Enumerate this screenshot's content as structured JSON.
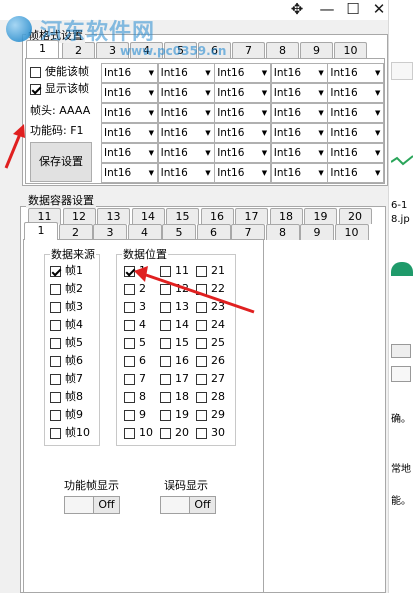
{
  "window": {
    "minimize_glyph": "—",
    "maximize_glyph": "☐",
    "close_glyph": "✕",
    "move_glyph": "✥"
  },
  "watermark": {
    "text": "河东软件网",
    "url": "www.pc0359.cn"
  },
  "frame_settings": {
    "legend": "帧格式设置",
    "tabs": [
      "1",
      "2",
      "3",
      "4",
      "5",
      "6",
      "7",
      "8",
      "9",
      "10"
    ],
    "enable_frame_label": "使能该帧",
    "enable_frame_checked": false,
    "show_frame_label": "显示该帧",
    "show_frame_checked": true,
    "header_label": "帧头: AAAA",
    "func_code_label": "功能码: F1",
    "save_button": "保存设置",
    "cell_value": "Int16",
    "rows": 6,
    "cols": 5
  },
  "data_container": {
    "legend": "数据容器设置",
    "tabs_row1": [
      "11",
      "12",
      "13",
      "14",
      "15",
      "16",
      "17",
      "18",
      "19",
      "20"
    ],
    "tabs_row2": [
      "1",
      "2",
      "3",
      "4",
      "5",
      "6",
      "7",
      "8",
      "9",
      "10"
    ],
    "source_header": "数据来源",
    "sources": [
      {
        "label": "帧1",
        "checked": true
      },
      {
        "label": "帧2",
        "checked": false
      },
      {
        "label": "帧3",
        "checked": false
      },
      {
        "label": "帧4",
        "checked": false
      },
      {
        "label": "帧5",
        "checked": false
      },
      {
        "label": "帧6",
        "checked": false
      },
      {
        "label": "帧7",
        "checked": false
      },
      {
        "label": "帧8",
        "checked": false
      },
      {
        "label": "帧9",
        "checked": false
      },
      {
        "label": "帧10",
        "checked": false
      }
    ],
    "position_header": "数据位置",
    "positions": {
      "col1": [
        {
          "label": "1",
          "checked": true
        },
        {
          "label": "2"
        },
        {
          "label": "3"
        },
        {
          "label": "4"
        },
        {
          "label": "5"
        },
        {
          "label": "6"
        },
        {
          "label": "7"
        },
        {
          "label": "8"
        },
        {
          "label": "9"
        },
        {
          "label": "10"
        }
      ],
      "col2": [
        {
          "label": "11"
        },
        {
          "label": "12"
        },
        {
          "label": "13"
        },
        {
          "label": "14"
        },
        {
          "label": "15"
        },
        {
          "label": "16"
        },
        {
          "label": "17"
        },
        {
          "label": "18"
        },
        {
          "label": "19"
        },
        {
          "label": "20"
        }
      ],
      "col3": [
        {
          "label": "21"
        },
        {
          "label": "22"
        },
        {
          "label": "23"
        },
        {
          "label": "24"
        },
        {
          "label": "25"
        },
        {
          "label": "26"
        },
        {
          "label": "27"
        },
        {
          "label": "28"
        },
        {
          "label": "29"
        },
        {
          "label": "30"
        }
      ]
    },
    "func_frame_display_label": "功能帧显示",
    "func_frame_display_value": "Off",
    "error_display_label": "误码显示",
    "error_display_value": "Off"
  },
  "right_strip_texts": [
    "6-1",
    "8.jp",
    "确。",
    "常地",
    "能。"
  ],
  "colors": {
    "annotation_arrow": "#e02020",
    "accent": "#2a8fd0"
  }
}
